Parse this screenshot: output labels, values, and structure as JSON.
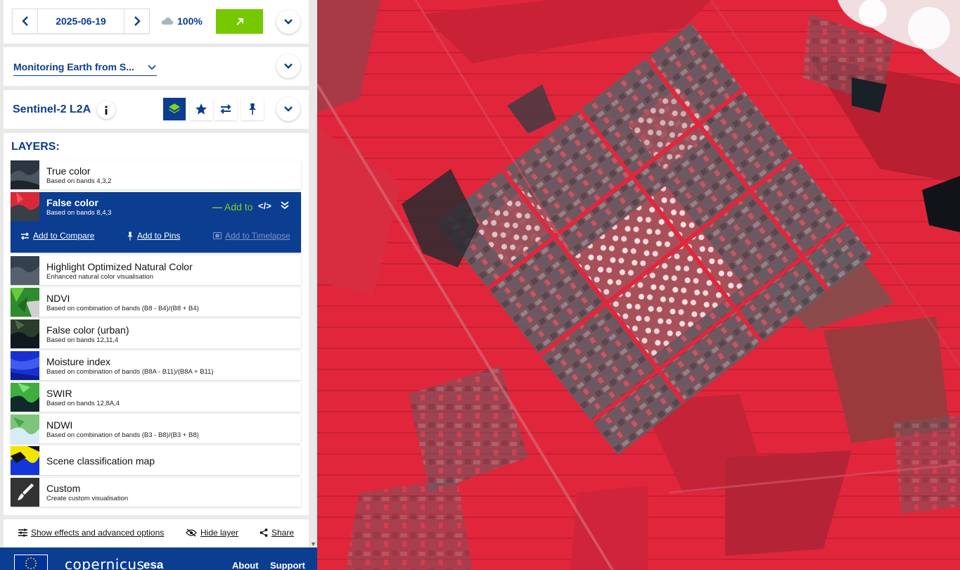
{
  "date_bar": {
    "date": "2025-06-19",
    "cloud_coverage": "100%"
  },
  "theme": {
    "selected": "Monitoring Earth from S..."
  },
  "dataset": {
    "title": "Sentinel-2 L2A"
  },
  "layers": {
    "heading": "LAYERS:",
    "items": [
      {
        "title": "True color",
        "desc": "Based on bands 4,3,2"
      },
      {
        "title": "False color",
        "desc": "Based on bands 8,4,3"
      },
      {
        "title": "Highlight Optimized Natural Color",
        "desc": "Enhanced natural color visualisation"
      },
      {
        "title": "NDVI",
        "desc": "Based on combination of bands (B8 - B4)/(B8 + B4)"
      },
      {
        "title": "False color (urban)",
        "desc": "Based on bands 12,11,4"
      },
      {
        "title": "Moisture index",
        "desc": "Based on combination of bands (B8A - B11)/(B8A + B11)"
      },
      {
        "title": "SWIR",
        "desc": "Based on bands 12,8A,4"
      },
      {
        "title": "NDWI",
        "desc": "Based on combination of bands (B3 - B8)/(B3 + B8)"
      },
      {
        "title": "Scene classification map",
        "desc": ""
      },
      {
        "title": "Custom",
        "desc": "Create custom visualisation"
      }
    ],
    "active_actions": {
      "add_to": "Add to",
      "compare": "Add to Compare",
      "pins": "Add to Pins",
      "timelapse": "Add to Timelapse"
    }
  },
  "bottom_bar": {
    "effects": "Show effects and advanced options",
    "hide_layer": "Hide layer",
    "share": "Share"
  },
  "footer": {
    "copernicus": "copernicus",
    "esa": "esa",
    "about": "About",
    "support": "Support"
  },
  "colors": {
    "brand_blue": "#0b3d91",
    "accent_green": "#76c900"
  }
}
